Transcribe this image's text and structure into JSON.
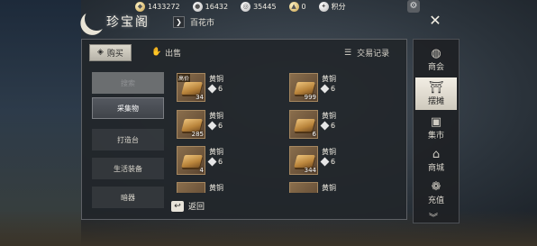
{
  "currencies": [
    {
      "icon": "ingot-currency-icon",
      "value": "1433272"
    },
    {
      "icon": "silver-currency-icon",
      "value": "16432"
    },
    {
      "icon": "coin-currency-icon",
      "value": "35445"
    },
    {
      "icon": "token-currency-icon",
      "value": "0"
    },
    {
      "icon": "points-icon",
      "value": "积分"
    }
  ],
  "title": "珍宝阁",
  "breadcrumb": "百花市",
  "tabs": [
    {
      "label": "购买",
      "icon": "bag-icon",
      "active": true
    },
    {
      "label": "出售",
      "icon": "hand-icon",
      "active": false
    }
  ],
  "record_label": "交易记录",
  "search_label": "搜索",
  "categories": [
    "采集物",
    "打造台",
    "生活装备",
    "暗器"
  ],
  "selected_category": "采集物",
  "items": [
    {
      "name": "黄铜",
      "price": "6",
      "qty": "34",
      "badge": "高价"
    },
    {
      "name": "黄铜",
      "price": "6",
      "qty": "999",
      "badge": ""
    },
    {
      "name": "黄铜",
      "price": "6",
      "qty": "285",
      "badge": ""
    },
    {
      "name": "黄铜",
      "price": "6",
      "qty": "6",
      "badge": ""
    },
    {
      "name": "黄铜",
      "price": "6",
      "qty": "4",
      "badge": ""
    },
    {
      "name": "黄铜",
      "price": "6",
      "qty": "344",
      "badge": ""
    },
    {
      "name": "黄铜",
      "price": "",
      "qty": "",
      "badge": ""
    },
    {
      "name": "黄铜",
      "price": "",
      "qty": "",
      "badge": ""
    }
  ],
  "back_label": "返回",
  "side_nav": [
    {
      "label": "商会",
      "icon": "guild-icon",
      "active": false
    },
    {
      "label": "摆摊",
      "icon": "stall-icon",
      "active": true
    },
    {
      "label": "集市",
      "icon": "market-icon",
      "active": false
    },
    {
      "label": "商城",
      "icon": "shop-icon",
      "active": false
    },
    {
      "label": "充值",
      "icon": "recharge-icon",
      "active": false
    }
  ]
}
